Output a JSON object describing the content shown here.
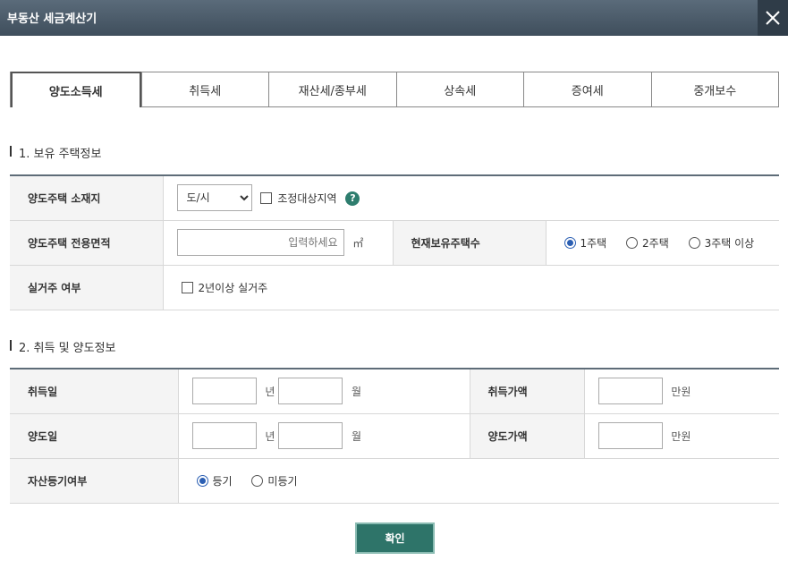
{
  "window": {
    "title": "부동산 세금계산기"
  },
  "tabs": [
    {
      "label": "양도소득세",
      "active": true
    },
    {
      "label": "취득세"
    },
    {
      "label": "재산세/종부세"
    },
    {
      "label": "상속세"
    },
    {
      "label": "증여세"
    },
    {
      "label": "중개보수"
    }
  ],
  "section1": {
    "title": "1. 보유 주택정보",
    "location_label": "양도주택 소재지",
    "location_select": "도/시",
    "adjust_area_label": "조정대상지역",
    "area_label": "양도주택 전용면적",
    "area_placeholder": "입력하세요",
    "area_unit": "㎡",
    "house_count_label": "현재보유주택수",
    "house_count_options": [
      "1주택",
      "2주택",
      "3주택 이상"
    ],
    "house_count_selected": "1주택",
    "residence_label": "실거주 여부",
    "residence_check_label": "2년이상 실거주"
  },
  "section2": {
    "title": "2. 취득 및 양도정보",
    "acq_date_label": "취득일",
    "acq_price_label": "취득가액",
    "transfer_date_label": "양도일",
    "transfer_price_label": "양도가액",
    "year_unit": "년",
    "month_unit": "월",
    "price_unit": "만원",
    "registration_label": "자산등기여부",
    "registration_options": [
      "등기",
      "미등기"
    ],
    "registration_selected": "등기"
  },
  "confirm_label": "확인"
}
